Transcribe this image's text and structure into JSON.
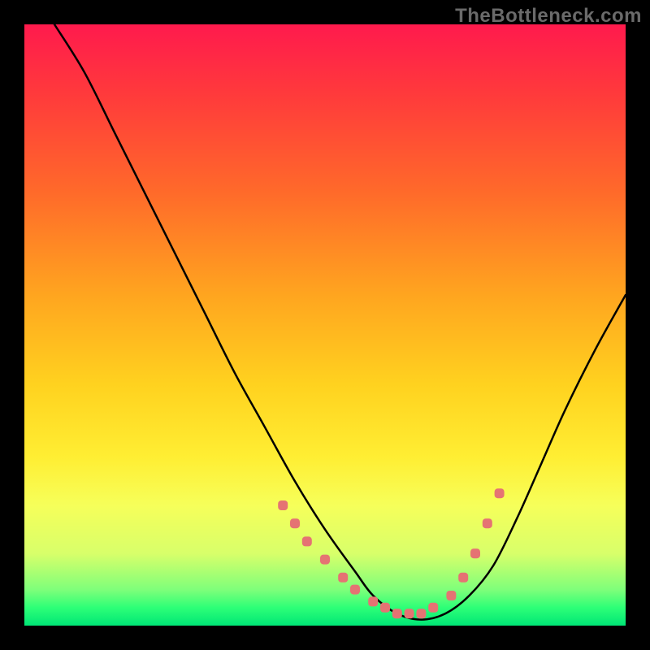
{
  "watermark": "TheBottleneck.com",
  "chart_data": {
    "type": "line",
    "title": "",
    "xlabel": "",
    "ylabel": "",
    "xlim": [
      0,
      100
    ],
    "ylim": [
      0,
      100
    ],
    "grid": false,
    "series": [
      {
        "name": "curve",
        "stroke": "#000000",
        "x": [
          5,
          10,
          15,
          20,
          25,
          30,
          35,
          40,
          45,
          50,
          55,
          58,
          62,
          66,
          70,
          74,
          78,
          82,
          86,
          90,
          95,
          100
        ],
        "y": [
          100,
          92,
          82,
          72,
          62,
          52,
          42,
          33,
          24,
          16,
          9,
          5,
          2,
          1,
          2,
          5,
          10,
          18,
          27,
          36,
          46,
          55
        ]
      }
    ],
    "markers": {
      "name": "highlight-dots",
      "color": "#e57373",
      "x": [
        43,
        45,
        47,
        50,
        53,
        55,
        58,
        60,
        62,
        64,
        66,
        68,
        71,
        73,
        75,
        77,
        79
      ],
      "y": [
        20,
        17,
        14,
        11,
        8,
        6,
        4,
        3,
        2,
        2,
        2,
        3,
        5,
        8,
        12,
        17,
        22
      ]
    }
  }
}
